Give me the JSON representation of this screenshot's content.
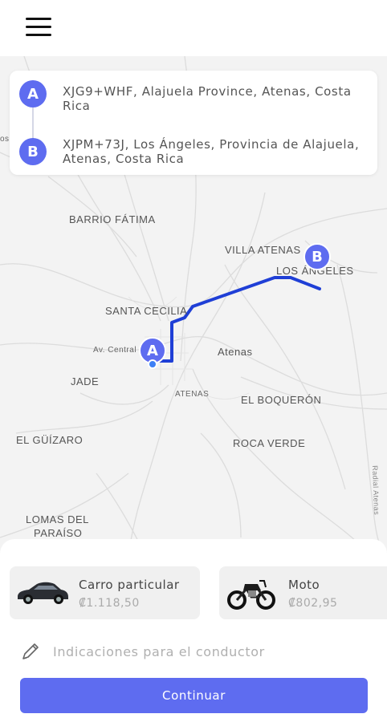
{
  "header": {
    "menu_icon": "hamburger-menu-icon"
  },
  "route": {
    "origin": {
      "marker": "A",
      "address": "XJG9+WHF, Alajuela Province, Atenas, Costa Rica"
    },
    "destination": {
      "marker": "B",
      "address": "XJPM+73J, Los Ángeles, Provincia de Alajuela, Atenas, Costa Rica"
    }
  },
  "map": {
    "labels": {
      "barrio_fatima": "BARRIO FÁTIMA",
      "villa_atenas": "VILLA ATENAS",
      "los_angeles": "LOS ÁNGELES",
      "santa_cecilia": "SANTA CECILIA",
      "av_central": "Av. Central",
      "atenas": "Atenas",
      "jade": "JADE",
      "atenas_small": "ATENAS",
      "el_boqueron": "EL BOQUERÓN",
      "el_guizaro": "EL GÜÍZARO",
      "roca_verde": "ROCA VERDE",
      "lomas_del": "LOMAS DEL",
      "paraiso": "PARAÍSO",
      "radial_atenas": "Radial Atenas",
      "edge_os": "os"
    },
    "marker_a": "A",
    "marker_b": "B",
    "route_color": "#1f3fd6",
    "accent": "#5e6cf0"
  },
  "vehicles": [
    {
      "name": "Carro particular",
      "price": "₡1.118,50",
      "icon": "car-icon"
    },
    {
      "name": "Moto",
      "price": "₡802,95",
      "icon": "motorcycle-icon"
    }
  ],
  "notes": {
    "placeholder": "Indicaciones para el conductor",
    "icon": "pencil-icon"
  },
  "continue_label": "Continuar"
}
